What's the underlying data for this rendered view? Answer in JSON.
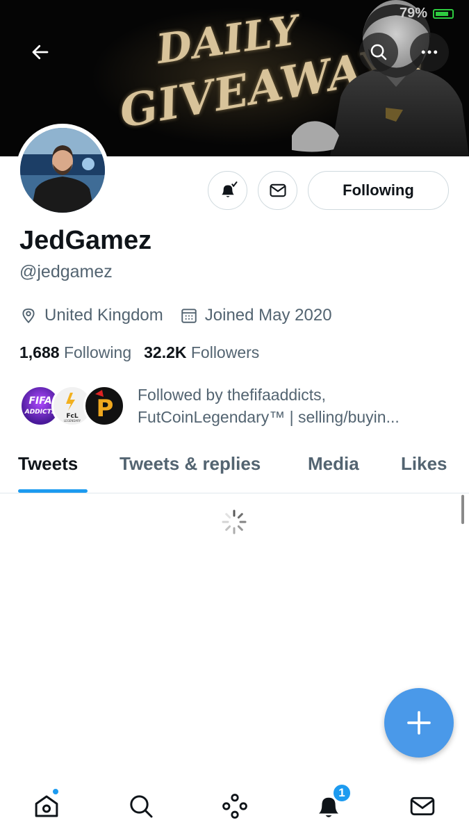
{
  "status_bar": {
    "battery": "79%"
  },
  "banner": {
    "line1": "DAILY",
    "line2": "GIVEAWAYS"
  },
  "profile": {
    "display_name": "JedGamez",
    "handle": "@jedgamez",
    "location": "United Kingdom",
    "joined": "Joined May 2020",
    "following_count": "1,688",
    "following_label": "Following",
    "followers_count": "32.2K",
    "followers_label": "Followers",
    "followed_by_line1": "Followed by thefifaaddicts,",
    "followed_by_line2": "FutCoinLegendary™ | selling/buyin...",
    "followed_by_avatars": [
      {
        "label_top": "FIFA",
        "label_bottom": "ADDICTS"
      },
      {
        "label": "FcL",
        "sub": "LEGENDARY"
      },
      {
        "label": "P"
      }
    ]
  },
  "actions": {
    "following_button": "Following"
  },
  "tabs": [
    {
      "label": "Tweets",
      "active": true
    },
    {
      "label": "Tweets & replies",
      "active": false
    },
    {
      "label": "Media",
      "active": false
    },
    {
      "label": "Likes",
      "active": false
    }
  ],
  "bottom_nav": {
    "items": [
      "home-icon",
      "search-icon",
      "spaces-icon",
      "notifications-icon",
      "messages-icon"
    ],
    "notification_badge": "1"
  },
  "colors": {
    "accent": "#1d9bf0",
    "fab": "#4a99e9",
    "muted_text": "#536471",
    "banner_text": "#d8c39a"
  }
}
